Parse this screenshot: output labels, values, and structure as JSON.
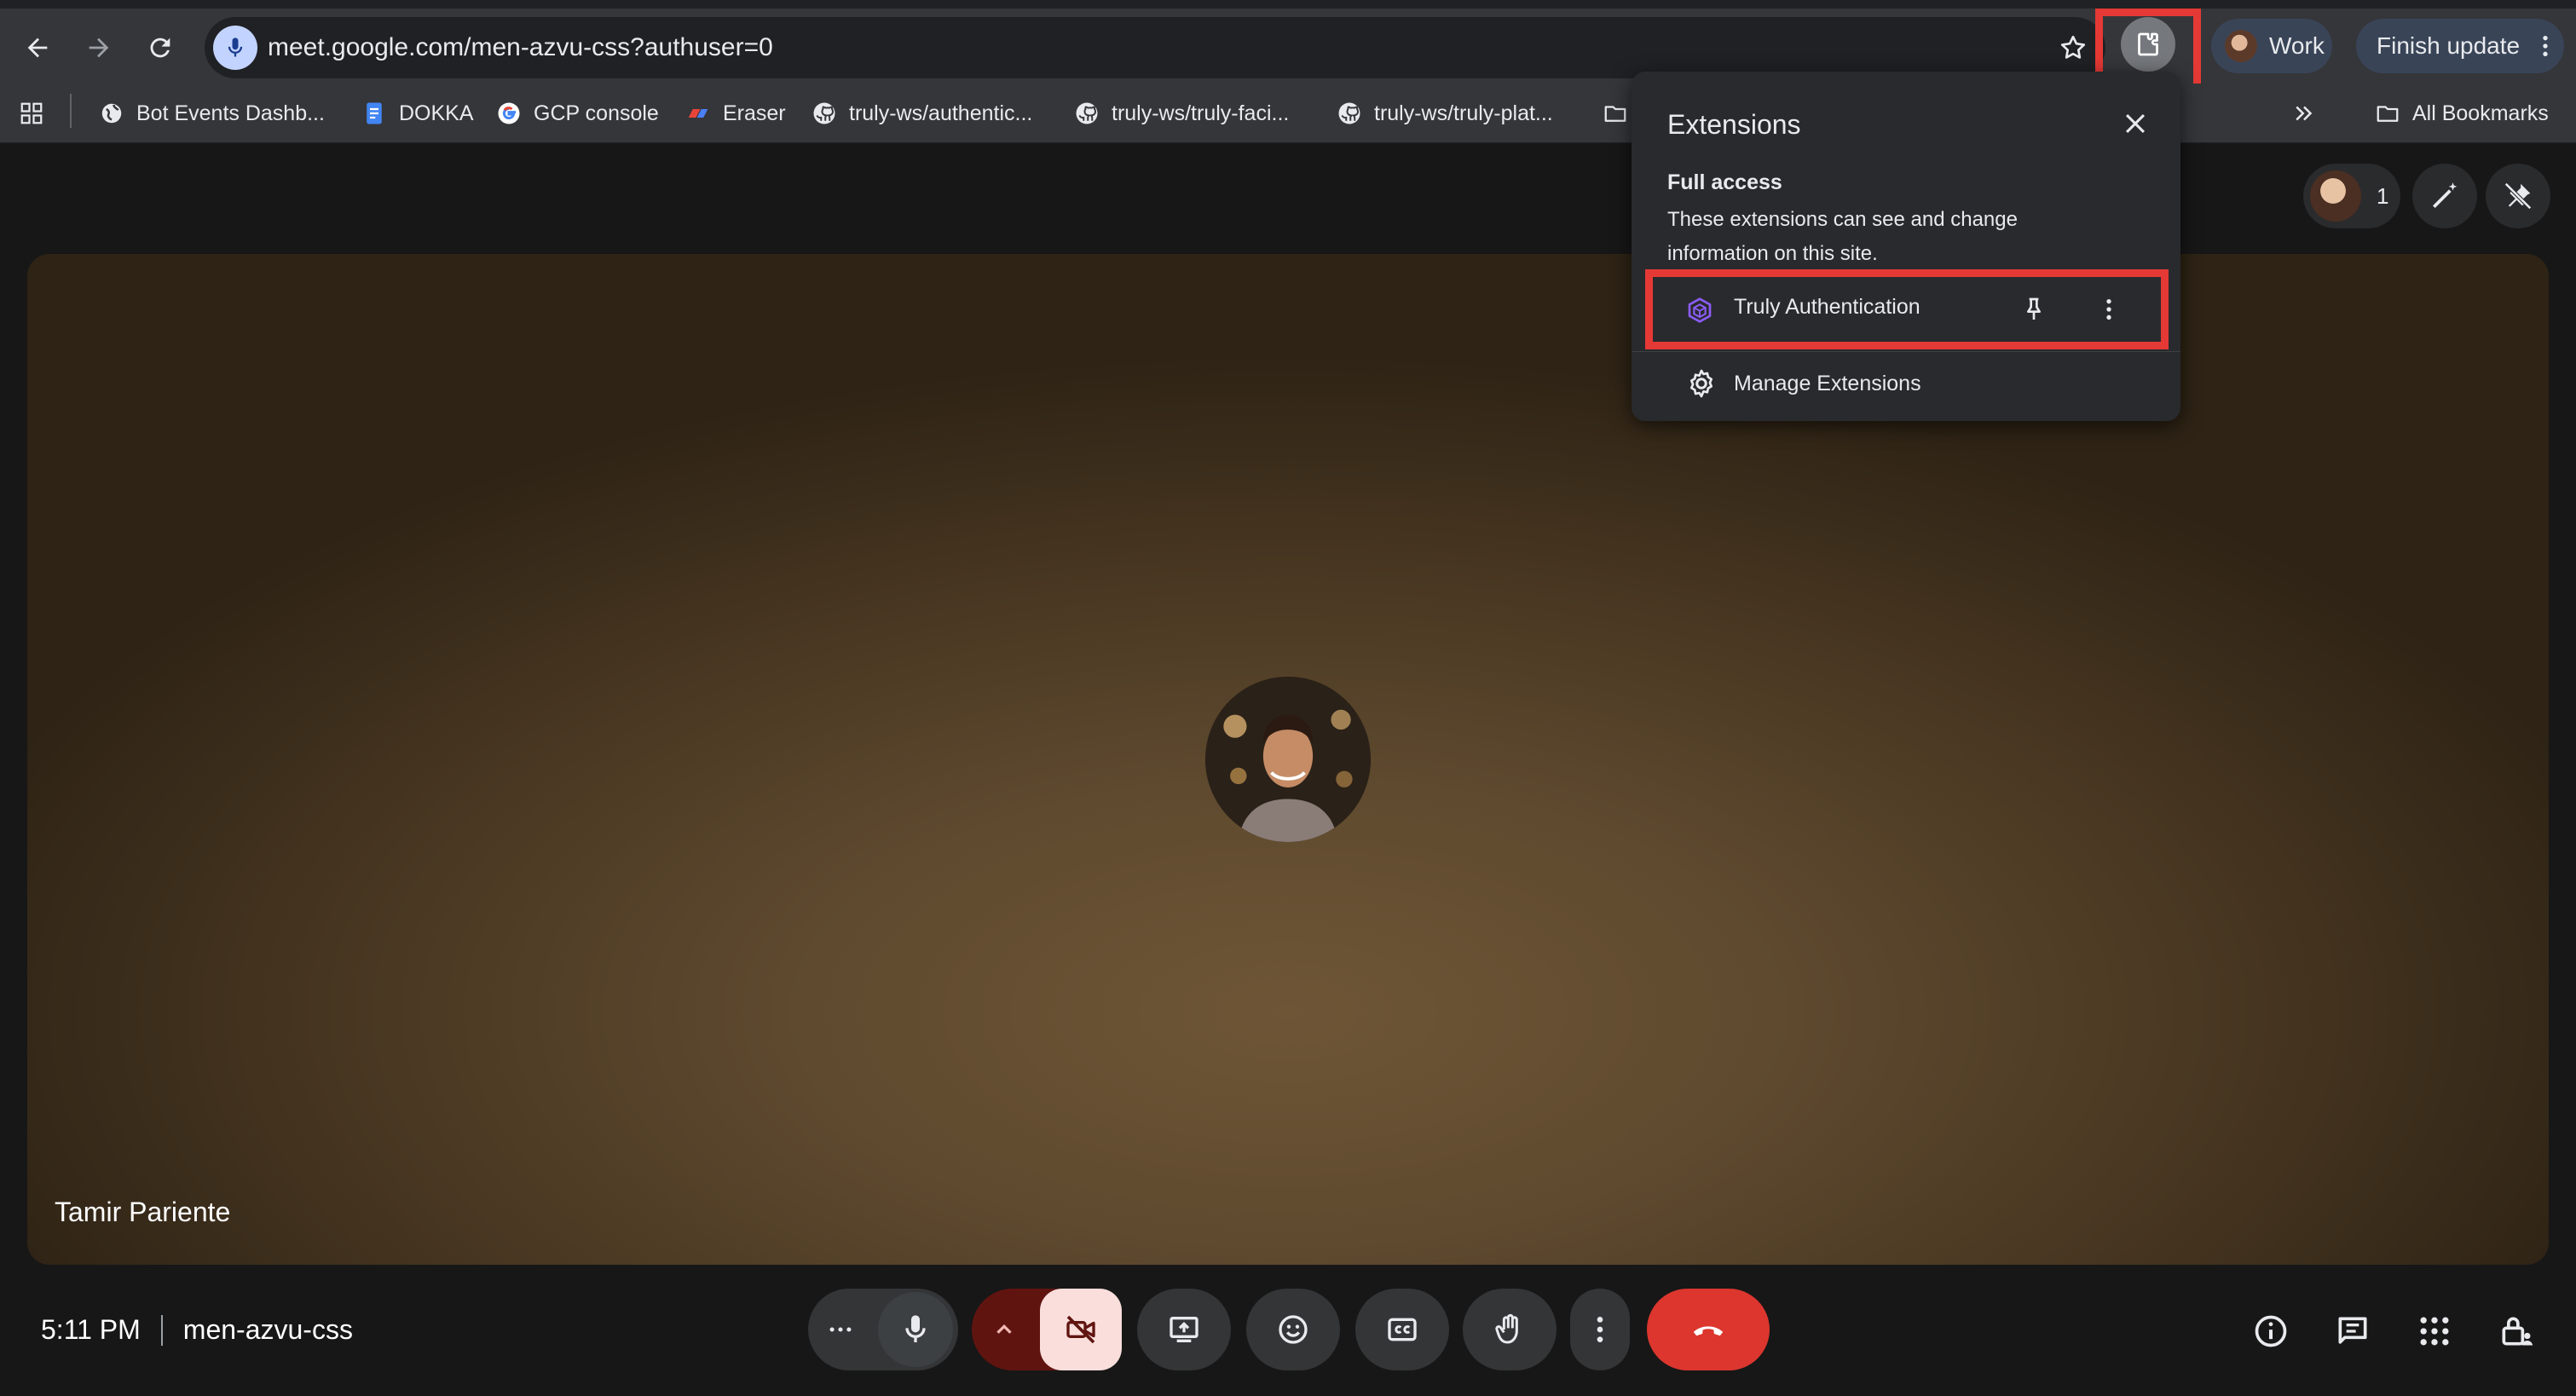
{
  "browser": {
    "url": "meet.google.com/men-azvu-css?authuser=0",
    "profile_label": "Work",
    "update_label": "Finish update"
  },
  "bookmarks": {
    "items": [
      {
        "label": "Bot Events Dashb...",
        "icon": "globe-icon"
      },
      {
        "label": "DOKKA",
        "icon": "docs-icon"
      },
      {
        "label": "GCP console",
        "icon": "google-icon"
      },
      {
        "label": "Eraser",
        "icon": "eraser-icon"
      },
      {
        "label": "truly-ws/authentic...",
        "icon": "github-icon"
      },
      {
        "label": "truly-ws/truly-faci...",
        "icon": "github-icon"
      },
      {
        "label": "truly-ws/truly-plat...",
        "icon": "github-icon"
      }
    ],
    "all_bookmarks": "All Bookmarks"
  },
  "extensions_popup": {
    "title": "Extensions",
    "section_title": "Full access",
    "section_desc": "These extensions can see and change information on this site.",
    "item_label": "Truly Authentication",
    "manage_label": "Manage Extensions"
  },
  "meet": {
    "participant_name": "Tamir Pariente",
    "participant_count": "1",
    "time": "5:11 PM",
    "meeting_code": "men-azvu-css"
  },
  "colors": {
    "highlight": "#e53935",
    "leave_button": "#dc362e",
    "camera_off": "#f9dedc"
  }
}
